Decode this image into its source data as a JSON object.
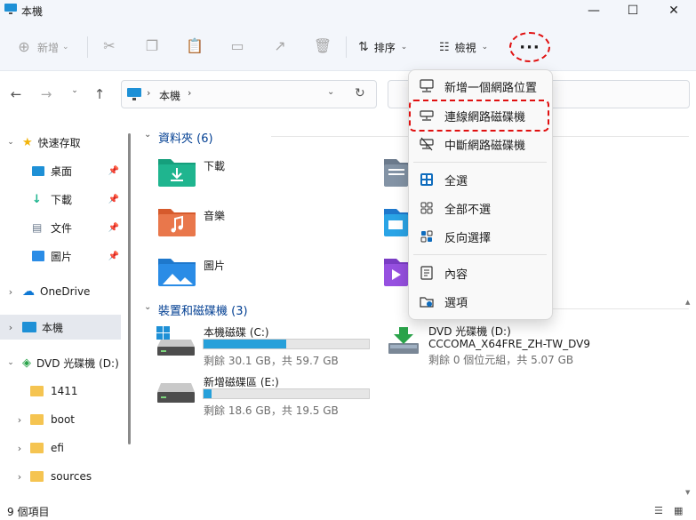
{
  "window": {
    "title": "本機",
    "minimize": "—",
    "maximize": "☐",
    "close": "✕"
  },
  "toolbar": {
    "new_label": "新增",
    "sort_label": "排序",
    "view_label": "檢視",
    "more_label": "···"
  },
  "address": {
    "path_1": "本機"
  },
  "sidebar": {
    "quick_access": "快速存取",
    "items": [
      {
        "label": "桌面"
      },
      {
        "label": "下載"
      },
      {
        "label": "文件"
      },
      {
        "label": "圖片"
      }
    ],
    "onedrive": "OneDrive",
    "this_pc": "本機",
    "dvd": "DVD 光碟機 (D:)",
    "dvd_children": [
      "1411",
      "boot",
      "efi",
      "sources"
    ]
  },
  "content": {
    "folders_header": "資料夾 (6)",
    "folders": [
      {
        "label": "下載",
        "color": "#1fb58f"
      },
      {
        "label": "音樂",
        "color": "#e86a3c"
      },
      {
        "label": "圖片",
        "color": "#2a8ce6"
      }
    ],
    "drives_header": "裝置和磁碟機 (3)",
    "drives": [
      {
        "name": "本機磁碟 (C:)",
        "detail": "剩餘 30.1 GB，共 59.7 GB",
        "used_fraction": 0.5
      },
      {
        "name": "新增磁碟區 (E:)",
        "detail": "剩餘 18.6 GB，共 19.5 GB",
        "used_fraction": 0.05
      }
    ],
    "dvd_drive": {
      "name": "DVD 光碟機 (D:)",
      "label": "CCCOMA_X64FRE_ZH-TW_DV9",
      "detail": "剩餘 0 個位元組，共 5.07 GB"
    }
  },
  "status": {
    "count": "9 個項目"
  },
  "menu": {
    "items": [
      {
        "label": "新增一個網路位置",
        "icon": "network-location-icon"
      },
      {
        "label": "連線網路磁碟機",
        "icon": "map-drive-icon"
      },
      {
        "label": "中斷網路磁碟機",
        "icon": "disconnect-drive-icon"
      },
      {
        "label": "全選",
        "icon": "select-all-icon"
      },
      {
        "label": "全部不選",
        "icon": "select-none-icon"
      },
      {
        "label": "反向選擇",
        "icon": "invert-selection-icon"
      },
      {
        "label": "內容",
        "icon": "properties-icon"
      },
      {
        "label": "選項",
        "icon": "options-icon"
      }
    ]
  },
  "colors": {
    "accent": "#0067c0",
    "highlight": "#e01010",
    "drive_fill": "#26a0da"
  }
}
